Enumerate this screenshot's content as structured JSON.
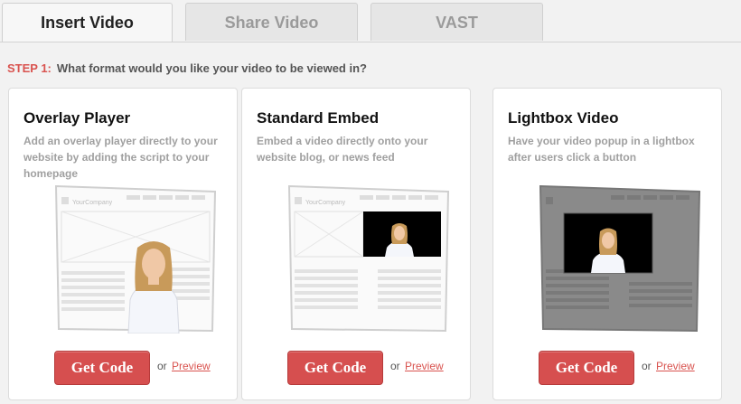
{
  "tabs": [
    {
      "label": "Insert Video"
    },
    {
      "label": "Share Video"
    },
    {
      "label": "VAST"
    }
  ],
  "step": {
    "label": "STEP 1:",
    "question": "What format would you like your video to be viewed in?"
  },
  "cards": [
    {
      "title": "Overlay Player",
      "description": "Add an overlay player directly to your website by adding the script to your homepage",
      "button": "Get Code",
      "or": "or",
      "preview": "Preview"
    },
    {
      "title": "Standard Embed",
      "description": "Embed a video directly onto your website blog, or news feed",
      "button": "Get Code",
      "or": "or",
      "preview": "Preview"
    },
    {
      "title": "Lightbox Video",
      "description": "Have your video popup in a lightbox after users click a button",
      "button": "Get Code",
      "or": "or",
      "preview": "Preview"
    }
  ],
  "mock": {
    "company": "YourCompany"
  },
  "colors": {
    "accent": "#d64f4f",
    "link": "#d9534f"
  }
}
